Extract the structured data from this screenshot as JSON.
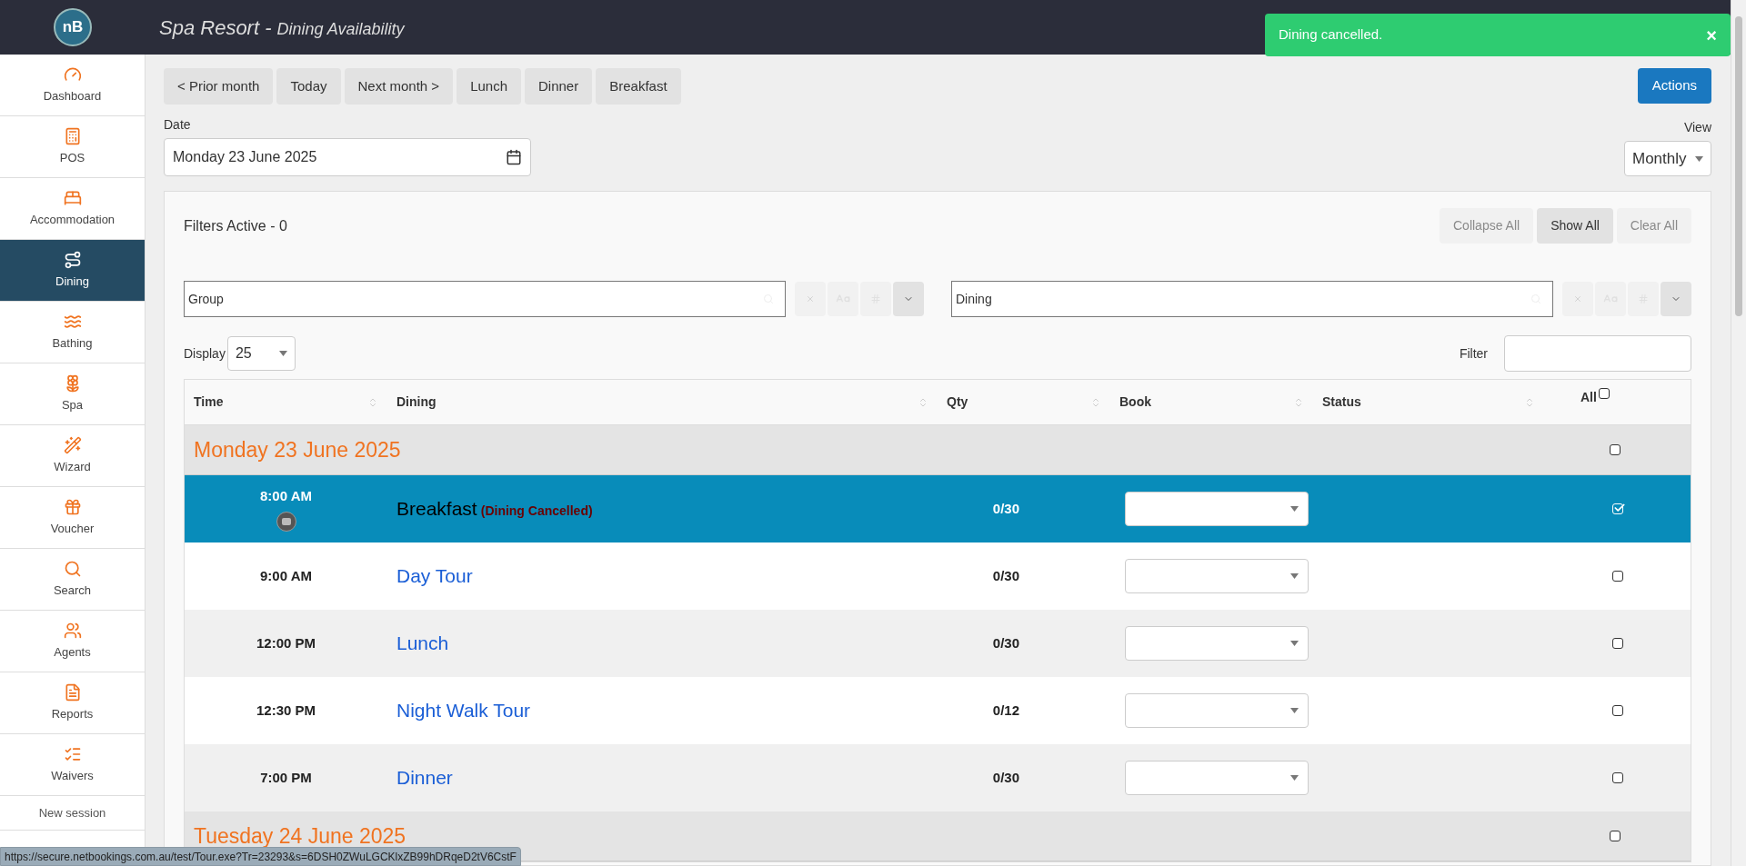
{
  "header": {
    "logo": "nB",
    "title": "Spa Resort -",
    "subtitle": "Dining Availability"
  },
  "toast": {
    "message": "Dining cancelled.",
    "close": "×"
  },
  "sidebar": {
    "items": [
      {
        "label": "Dashboard",
        "selected": false
      },
      {
        "label": "POS",
        "selected": false
      },
      {
        "label": "Accommodation",
        "selected": false
      },
      {
        "label": "Dining",
        "selected": true
      },
      {
        "label": "Bathing",
        "selected": false
      },
      {
        "label": "Spa",
        "selected": false
      },
      {
        "label": "Wizard",
        "selected": false
      },
      {
        "label": "Voucher",
        "selected": false
      },
      {
        "label": "Search",
        "selected": false
      },
      {
        "label": "Agents",
        "selected": false
      },
      {
        "label": "Reports",
        "selected": false
      },
      {
        "label": "Waivers",
        "selected": false
      }
    ],
    "footer": "New session"
  },
  "toolbar": {
    "buttons": [
      "< Prior month",
      "Today",
      "Next month >",
      "Lunch",
      "Dinner",
      "Breakfast"
    ],
    "actions": "Actions"
  },
  "date": {
    "label": "Date",
    "value": "Monday 23 June 2025"
  },
  "view": {
    "label": "View",
    "value": "Monthly"
  },
  "filters": {
    "title": "Filters Active - 0",
    "buttons": [
      {
        "label": "Collapse All",
        "disabled": true
      },
      {
        "label": "Show All",
        "disabled": false
      },
      {
        "label": "Clear All",
        "disabled": true
      }
    ],
    "fields": [
      {
        "value": "Group"
      },
      {
        "value": "Dining"
      }
    ]
  },
  "display": {
    "label": "Display",
    "value": "25"
  },
  "filter": {
    "label": "Filter"
  },
  "table": {
    "columns": [
      "Time",
      "Dining",
      "Qty",
      "Book",
      "Status",
      "All"
    ],
    "all_checked": false,
    "rows": [
      {
        "kind": "group",
        "label": "Monday 23 June 2025",
        "checked": false
      },
      {
        "kind": "session",
        "time": "8:00 AM",
        "name": "Breakfast",
        "note": "(Dining Cancelled)",
        "qty": "0/30",
        "selected": true,
        "checked": true,
        "badge": true
      },
      {
        "kind": "session",
        "time": "9:00 AM",
        "name": "Day Tour",
        "qty": "0/30",
        "selected": false,
        "checked": false,
        "badge": false
      },
      {
        "kind": "session",
        "time": "12:00 PM",
        "name": "Lunch",
        "qty": "0/30",
        "selected": false,
        "checked": false,
        "badge": false
      },
      {
        "kind": "session",
        "time": "12:30 PM",
        "name": "Night Walk Tour",
        "qty": "0/12",
        "selected": false,
        "checked": false,
        "badge": false
      },
      {
        "kind": "session",
        "time": "7:00 PM",
        "name": "Dinner",
        "qty": "0/30",
        "selected": false,
        "checked": false,
        "badge": false
      },
      {
        "kind": "group",
        "label": "Tuesday 24 June 2025",
        "checked": false
      }
    ]
  },
  "status_bar": {
    "url": "https://secure.netbookings.com.au/test/Tour.exe?Tr=23293&s=6DSH0ZWuLGCKlxZB99hDRqeD2tV6CstF"
  }
}
